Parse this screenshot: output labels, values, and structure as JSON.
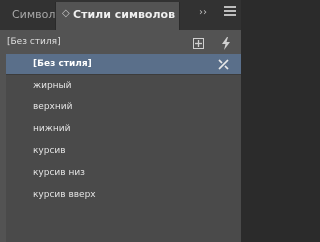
{
  "tabs": [
    {
      "label": "Символ"
    },
    {
      "label": "Стили символов",
      "arrow": "◇"
    }
  ],
  "tabbar": {
    "more": "››"
  },
  "toolbar": {
    "current_style": "[Без стиля]"
  },
  "styles": [
    {
      "label": "[Без стиля]"
    },
    {
      "label": "жирный"
    },
    {
      "label": "верхний"
    },
    {
      "label": "нижний"
    },
    {
      "label": "курсив"
    },
    {
      "label": "курсив низ"
    },
    {
      "label": "курсив вверх"
    }
  ]
}
